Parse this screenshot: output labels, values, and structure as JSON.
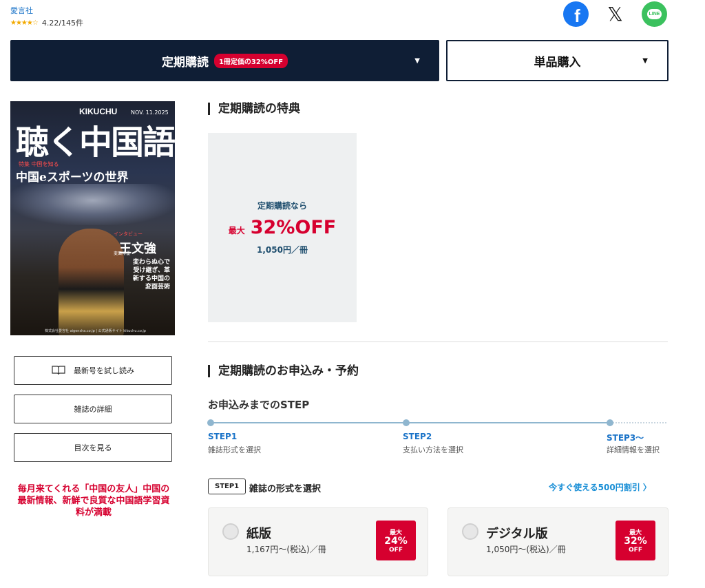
{
  "header": {
    "publisher": "愛言社",
    "stars": "★★★★☆",
    "rating": "4.22/145件",
    "share": {
      "facebook_icon": "f",
      "x_icon": "𝕏",
      "line_icon": "LINE"
    }
  },
  "tabs": {
    "subscription": {
      "label": "定期購読",
      "badge": "1冊定価の32%OFF",
      "arrow": "▼"
    },
    "single": {
      "label": "単品購入",
      "arrow": "▼"
    }
  },
  "cover": {
    "brand": "KIKUCHU",
    "issue": "NOV. 11.2025",
    "title": "聴く中国語",
    "special": "特集 中国を知る",
    "feature": "中国eスポーツの世界",
    "interview": "インタビュー",
    "role": "変面俳優",
    "person": "王文強",
    "desc": "変わらぬ心で受け継ぎ、革新する中国の変面芸術",
    "footer": "株式会社愛言社 aigensha.co.jp | 公式通販サイト kikuchu.co.jp"
  },
  "sidebar": {
    "buttons": [
      "最新号を試し読み",
      "雑誌の詳細",
      "目次を見る"
    ],
    "tagline": "毎月来てくれる「中国の友人」中国の最新情報、新鮮で良質な中国語学習資料が満載"
  },
  "benefits": {
    "title": "定期購読の特典",
    "lead": "定期購読なら",
    "max": "最大",
    "pct": "32%OFF",
    "price": "1,050円／冊"
  },
  "apply": {
    "title": "定期購読のお申込み・予約",
    "steps_heading": "お申込みまでのSTEP",
    "steps": [
      {
        "label": "STEP1",
        "desc": "雑誌形式を選択"
      },
      {
        "label": "STEP2",
        "desc": "支払い方法を選択"
      },
      {
        "label": "STEP3〜",
        "desc": "詳細情報を選択"
      }
    ],
    "step1_badge": "STEP1",
    "step1_title": "雑誌の形式を選択",
    "discount_link": "今すぐ使える500円割引 〉",
    "formats": [
      {
        "name": "紙版",
        "price": "1,167円〜(税込)／冊",
        "badge_top": "最大",
        "badge_pct": "24%",
        "badge_off": "OFF"
      },
      {
        "name": "デジタル版",
        "price": "1,050円〜(税込)／冊",
        "badge_top": "最大",
        "badge_pct": "32%",
        "badge_off": "OFF"
      }
    ]
  },
  "colors": {
    "navy": "#0f1e35",
    "accent_red": "#d6002f",
    "link_blue": "#1a73c8",
    "step_blue": "#8fb6cf"
  }
}
